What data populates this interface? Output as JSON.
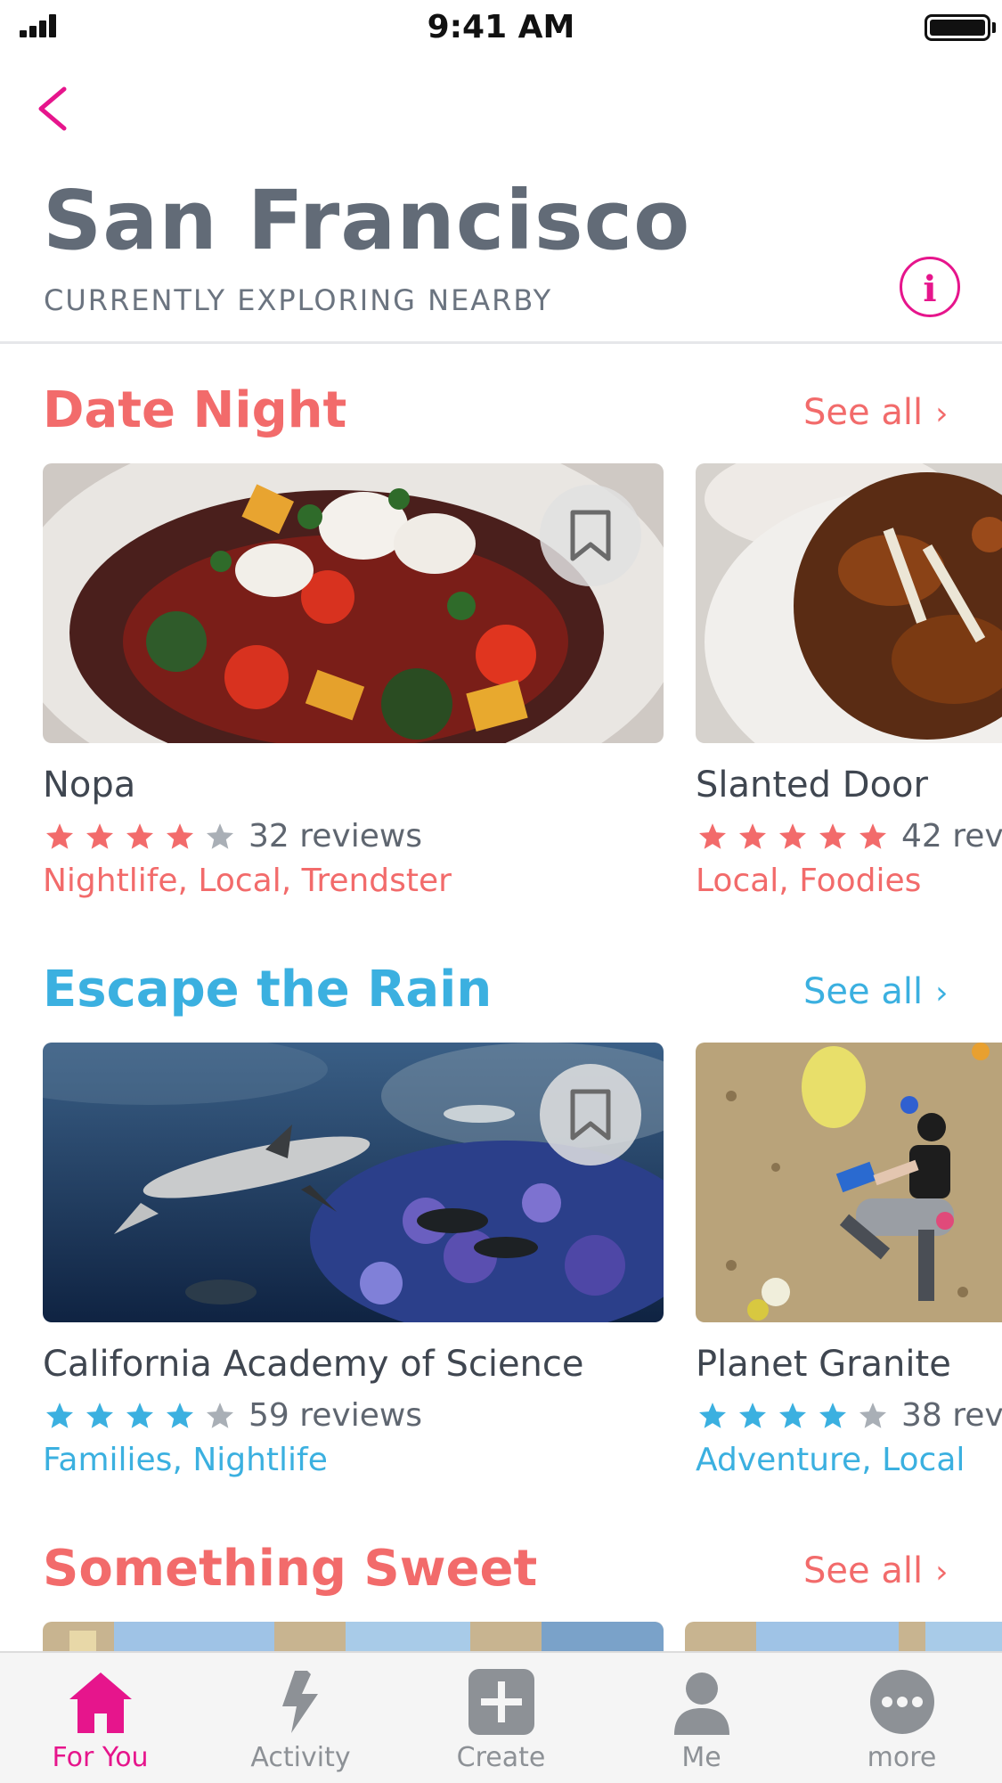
{
  "status_bar": {
    "time": "9:41 AM"
  },
  "header": {
    "title": "San Francisco",
    "subtitle": "CURRENTLY EXPLORING NEARBY"
  },
  "colors": {
    "accent": "#e6158c",
    "coral": "#f26b6b",
    "blue": "#3bb0e0",
    "star_empty": "#a9afb6"
  },
  "sections": [
    {
      "title": "Date Night",
      "see_all": "See all",
      "cards": [
        {
          "name": "Nopa",
          "rating": 4,
          "reviews": "32 reviews",
          "tags": "Nightlife, Local, Trendster"
        },
        {
          "name": "Slanted Door",
          "rating": 5,
          "reviews": "42 rev",
          "tags": "Local, Foodies"
        }
      ]
    },
    {
      "title": "Escape the Rain",
      "see_all": "See all",
      "cards": [
        {
          "name": "California Academy of Science",
          "rating": 4,
          "reviews": "59 reviews",
          "tags": "Families, Nightlife"
        },
        {
          "name": "Planet Granite",
          "rating": 4,
          "reviews": "38 rev",
          "tags": "Adventure, Local"
        }
      ]
    },
    {
      "title": "Something Sweet",
      "see_all": "See all",
      "cards": []
    }
  ],
  "tab_bar": {
    "active": "For You",
    "tabs": [
      {
        "label": "For You",
        "icon": "home-icon"
      },
      {
        "label": "Activity",
        "icon": "lightning-icon"
      },
      {
        "label": "Create",
        "icon": "plus-square-icon"
      },
      {
        "label": "Me",
        "icon": "person-icon"
      },
      {
        "label": "more",
        "icon": "more-dots-icon"
      }
    ]
  }
}
